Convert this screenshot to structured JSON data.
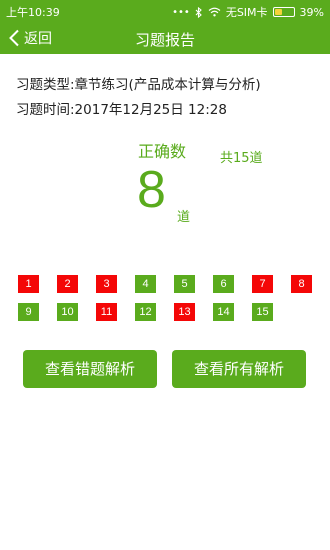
{
  "status_bar": {
    "time": "上午10:39",
    "icons": [
      "dots-icon",
      "bluetooth-icon",
      "wifi-icon"
    ],
    "carrier": "无SIM卡",
    "battery_percent": "39%",
    "battery_level": 0.39
  },
  "nav": {
    "back_label": "返回",
    "title": "习题报告"
  },
  "info": {
    "type_label": "习题类型:章节练习(产品成本计算与分析)",
    "time_label": "习题时间:2017年12月25日  12:28"
  },
  "score": {
    "correct_label": "正确数",
    "correct_count": "8",
    "unit": "道",
    "total_label": "共15道"
  },
  "questions": [
    {
      "num": "1",
      "correct": false
    },
    {
      "num": "2",
      "correct": false
    },
    {
      "num": "3",
      "correct": false
    },
    {
      "num": "4",
      "correct": true
    },
    {
      "num": "5",
      "correct": true
    },
    {
      "num": "6",
      "correct": true
    },
    {
      "num": "7",
      "correct": false
    },
    {
      "num": "8",
      "correct": false
    },
    {
      "num": "9",
      "correct": true
    },
    {
      "num": "10",
      "correct": true
    },
    {
      "num": "11",
      "correct": false
    },
    {
      "num": "12",
      "correct": true
    },
    {
      "num": "13",
      "correct": false
    },
    {
      "num": "14",
      "correct": true
    },
    {
      "num": "15",
      "correct": true
    }
  ],
  "buttons": {
    "view_wrong": "查看错题解析",
    "view_all": "查看所有解析"
  },
  "colors": {
    "brand_green": "#5aab1d",
    "wrong_red": "#f40707"
  }
}
